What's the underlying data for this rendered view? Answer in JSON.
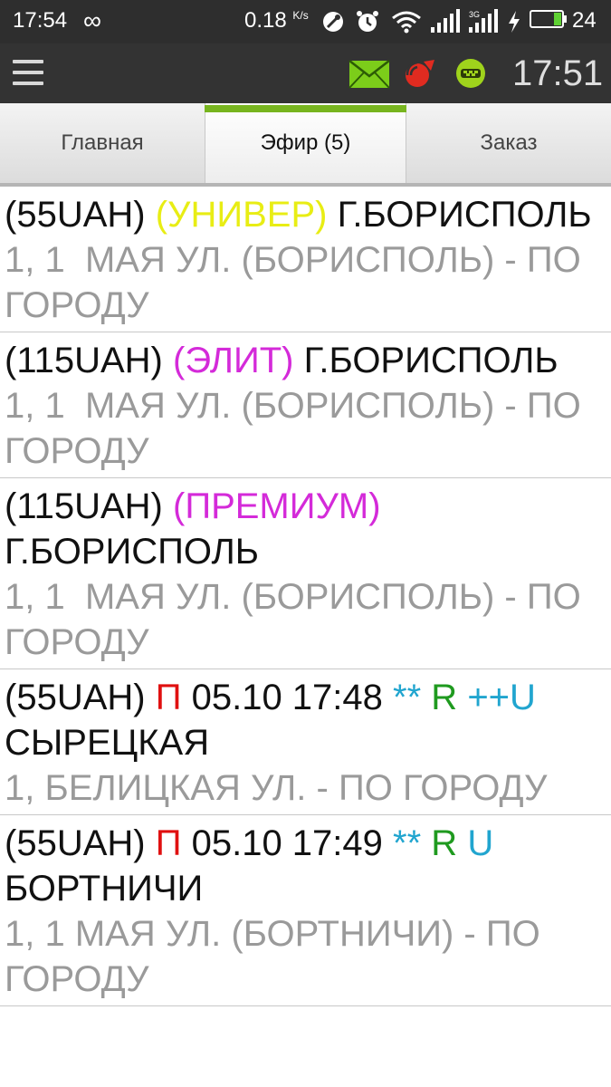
{
  "status_bar": {
    "time": "17:54",
    "link_symbol": "∞",
    "net_speed": "0.18",
    "net_speed_unit": "K/s",
    "network_label": "3G",
    "battery_level": "24",
    "battery_fill": 0.24,
    "icons": [
      "infinity-icon",
      "hotspot-icon",
      "alarm-icon",
      "wifi-icon",
      "signal-icon",
      "signal-3g-icon",
      "charging-icon",
      "battery-icon"
    ]
  },
  "app_bar": {
    "clock": "17:51",
    "icons": [
      "menu-icon",
      "message-envelope-icon",
      "gps-signal-icon",
      "taxi-icon"
    ],
    "colors": {
      "envelope": "#7ccd1a",
      "gps": "#e02b20",
      "taxi": "#9fd31c"
    }
  },
  "tabs": [
    {
      "label": "Главная"
    },
    {
      "label": "Эфир (5)"
    },
    {
      "label": "Заказ"
    }
  ],
  "orders": [
    {
      "price": "(55UAH)",
      "tag": "(УНИВЕР)",
      "tag_color": "#e8ed14",
      "area": "Г.БОРИСПОЛЬ",
      "address": "1, 1  МАЯ УЛ. (БОРИСПОЛЬ) - ПО ГОРОДУ"
    },
    {
      "price": "(115UAH)",
      "tag": "(ЭЛИТ)",
      "tag_color": "#d42ad9",
      "area": "Г.БОРИСПОЛЬ",
      "address": "1, 1  МАЯ УЛ. (БОРИСПОЛЬ) - ПО ГОРОДУ"
    },
    {
      "price": "(115UAH)",
      "tag": "(ПРЕМИУМ)",
      "tag_color": "#d42ad9",
      "area": "Г.БОРИСПОЛЬ",
      "address": "1, 1  МАЯ УЛ. (БОРИСПОЛЬ) - ПО ГОРОДУ"
    },
    {
      "price": "(55UAH)",
      "flag": "П",
      "datetime": "05.10 17:48",
      "stars": "**",
      "r": "R",
      "u": "++U",
      "area": "СЫРЕЦКАЯ",
      "address": "1, БЕЛИЦКАЯ УЛ. - ПО ГОРОДУ"
    },
    {
      "price": "(55UAH)",
      "flag": "П",
      "datetime": "05.10 17:49",
      "stars": "**",
      "r": "R",
      "u": "U",
      "area": "БОРТНИЧИ",
      "address": "1, 1 МАЯ УЛ. (БОРТНИЧИ) - ПО ГОРОДУ"
    }
  ],
  "colors": {
    "flag": "#e01010",
    "stars": "#21a5cf",
    "r": "#1f9a1f",
    "u": "#21a5cf",
    "address": "#9a9a9a",
    "tab_accent": "#78b51f"
  }
}
